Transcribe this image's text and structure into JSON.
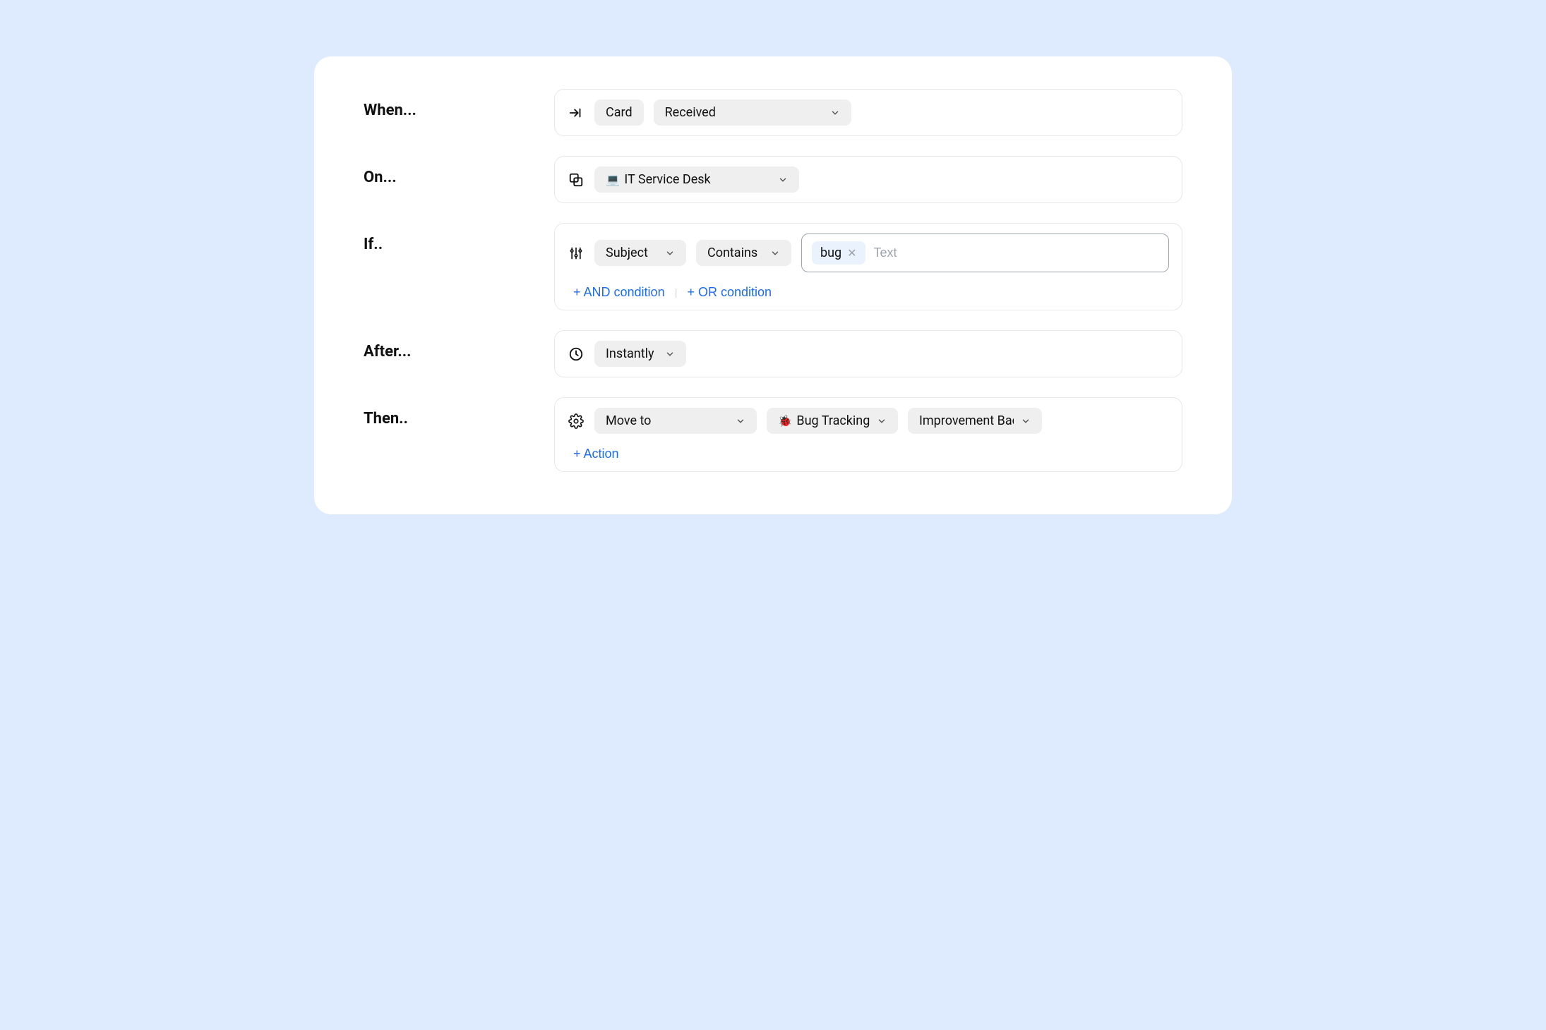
{
  "labels": {
    "when": "When...",
    "on": "On...",
    "if": "If..",
    "after": "After...",
    "then": "Then.."
  },
  "when": {
    "entity": "Card",
    "event": "Received"
  },
  "on": {
    "board_emoji": "💻",
    "board_name": "IT Service Desk"
  },
  "if": {
    "field": "Subject",
    "operator": "Contains",
    "chips": [
      "bug"
    ],
    "placeholder": "Text",
    "add_and": "+ AND condition",
    "add_or": "+ OR condition"
  },
  "after": {
    "delay": "Instantly"
  },
  "then": {
    "action": "Move to",
    "target_board_emoji": "🐞",
    "target_board": "Bug Tracking",
    "target_list": "Improvement Backlog",
    "add_action": "+ Action"
  }
}
